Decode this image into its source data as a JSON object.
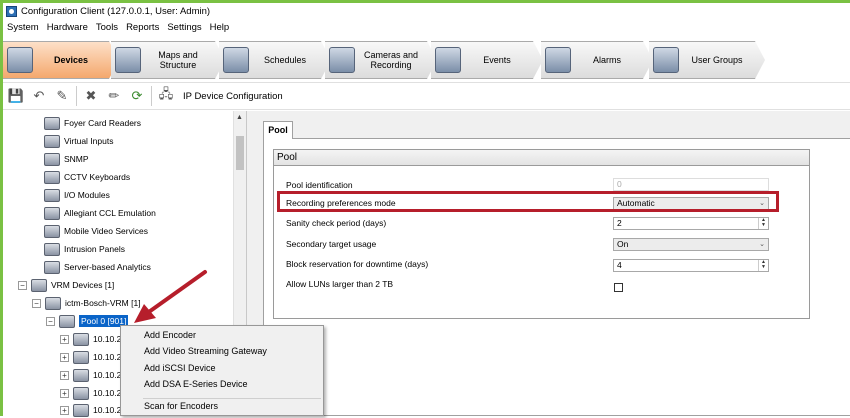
{
  "window": {
    "title": "Configuration Client (127.0.0.1, User: Admin)"
  },
  "menu": [
    "System",
    "Hardware",
    "Tools",
    "Reports",
    "Settings",
    "Help"
  ],
  "workflow_tabs": [
    {
      "label": "Devices",
      "icon": "devices-icon",
      "active": true
    },
    {
      "label": "Maps and\nStructure",
      "icon": "maps-icon",
      "active": false
    },
    {
      "label": "Schedules",
      "icon": "schedules-icon",
      "active": false
    },
    {
      "label": "Cameras and\nRecording",
      "icon": "cameras-icon",
      "active": false
    },
    {
      "label": "Events",
      "icon": "events-icon",
      "active": false
    },
    {
      "label": "Alarms",
      "icon": "alarms-icon",
      "active": false
    },
    {
      "label": "User Groups",
      "icon": "user-groups-icon",
      "active": false
    }
  ],
  "toolbar": {
    "buttons": [
      "save-icon",
      "undo-icon",
      "delete-icon",
      "rename-icon",
      "refresh-icon",
      "ip-device-config-icon"
    ],
    "ip_device_label": "IP Device Configuration"
  },
  "tree": {
    "items": [
      {
        "label": "Foyer Card Readers",
        "icon": "card-reader-icon"
      },
      {
        "label": "Virtual Inputs",
        "icon": "virtual-input-icon"
      },
      {
        "label": "SNMP",
        "icon": "snmp-icon"
      },
      {
        "label": "CCTV Keyboards",
        "icon": "keyboard-icon"
      },
      {
        "label": "I/O Modules",
        "icon": "io-module-icon"
      },
      {
        "label": "Allegiant CCL Emulation",
        "icon": "allegiant-icon"
      },
      {
        "label": "Mobile Video Services",
        "icon": "mobile-video-icon"
      },
      {
        "label": "Intrusion Panels",
        "icon": "intrusion-panel-icon"
      },
      {
        "label": "Server-based Analytics",
        "icon": "analytics-icon"
      },
      {
        "label": "VRM Devices [1]",
        "icon": "vrm-devices-icon"
      },
      {
        "label": "ictm-Bosch-VRM [1]",
        "icon": "vrm-server-icon"
      },
      {
        "label": "Pool 0 [901]",
        "icon": "pool-icon"
      },
      {
        "label": "10.10.2",
        "icon": "encoder-icon"
      },
      {
        "label": "10.10.2",
        "icon": "encoder-icon"
      },
      {
        "label": "10.10.2",
        "icon": "encoder-icon"
      },
      {
        "label": "10.10.2",
        "icon": "encoder-icon"
      },
      {
        "label": "10.10.2",
        "icon": "encoder-icon"
      }
    ]
  },
  "pool_tab": {
    "label": "Pool"
  },
  "group": {
    "title": "Pool"
  },
  "properties": [
    {
      "label": "Pool identification",
      "value": "0"
    },
    {
      "label": "Recording preferences mode",
      "value": "Automatic"
    },
    {
      "label": "Sanity check period (days)",
      "value": "2"
    },
    {
      "label": "Secondary target usage",
      "value": "On"
    },
    {
      "label": "Block reservation for downtime (days)",
      "value": "4"
    },
    {
      "label": "Allow LUNs larger than 2 TB",
      "value": ""
    }
  ],
  "context_menu": [
    "Add Encoder",
    "Add Video Streaming Gateway",
    "Add iSCSI Device",
    "Add DSA E-Series Device",
    "Scan for Encoders"
  ],
  "colors": {
    "accent": "#7ac143",
    "highlight_box": "#b61e2b",
    "selection": "#0a64c8",
    "annotation_arrow": "#b61e2b"
  }
}
